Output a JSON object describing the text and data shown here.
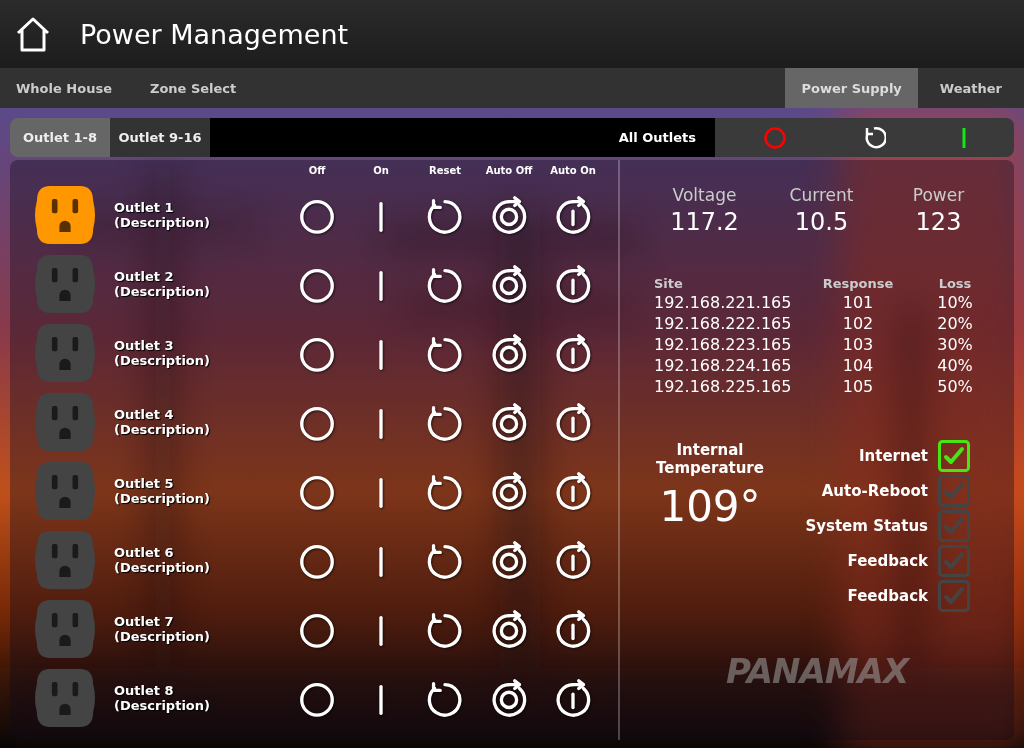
{
  "header": {
    "title": "Power Management"
  },
  "nav": [
    {
      "label": "Whole House",
      "selected": false
    },
    {
      "label": "Zone Select",
      "selected": false
    },
    {
      "label": "Power Supply",
      "selected": true
    },
    {
      "label": "Weather",
      "selected": false
    }
  ],
  "outlet_groups": [
    {
      "label": "Outlet 1-8",
      "selected": true
    },
    {
      "label": "Outlet 9-16",
      "selected": false
    }
  ],
  "all_outlets": {
    "label": "All Outlets"
  },
  "columns": [
    "Off",
    "On",
    "Reset",
    "Auto Off",
    "Auto On"
  ],
  "outlets": [
    {
      "name": "Outlet 1",
      "description": "(Description)",
      "on": true
    },
    {
      "name": "Outlet 2",
      "description": "(Description)",
      "on": false
    },
    {
      "name": "Outlet 3",
      "description": "(Description)",
      "on": false
    },
    {
      "name": "Outlet 4",
      "description": "(Description)",
      "on": false
    },
    {
      "name": "Outlet 5",
      "description": "(Description)",
      "on": false
    },
    {
      "name": "Outlet 6",
      "description": "(Description)",
      "on": false
    },
    {
      "name": "Outlet 7",
      "description": "(Description)",
      "on": false
    },
    {
      "name": "Outlet 8",
      "description": "(Description)",
      "on": false
    }
  ],
  "readings": [
    {
      "label": "Voltage",
      "value": "117.2"
    },
    {
      "label": "Current",
      "value": "10.5"
    },
    {
      "label": "Power",
      "value": "123"
    }
  ],
  "sites": {
    "columns": [
      "Site",
      "Response",
      "Loss"
    ],
    "rows": [
      [
        "192.168.221.165",
        "101",
        "10%"
      ],
      [
        "192.168.222.165",
        "102",
        "20%"
      ],
      [
        "192.168.223.165",
        "103",
        "30%"
      ],
      [
        "192.168.224.165",
        "104",
        "40%"
      ],
      [
        "192.168.225.165",
        "105",
        "50%"
      ]
    ]
  },
  "temperature": {
    "label": "Internal Temperature",
    "value": "109°"
  },
  "status": [
    {
      "label": "Internet",
      "checked": true
    },
    {
      "label": "Auto-Reboot",
      "checked": false
    },
    {
      "label": "System Status",
      "checked": false
    },
    {
      "label": "Feedback",
      "checked": false
    },
    {
      "label": "Feedback",
      "checked": false
    }
  ],
  "logo": "PANAMAX"
}
